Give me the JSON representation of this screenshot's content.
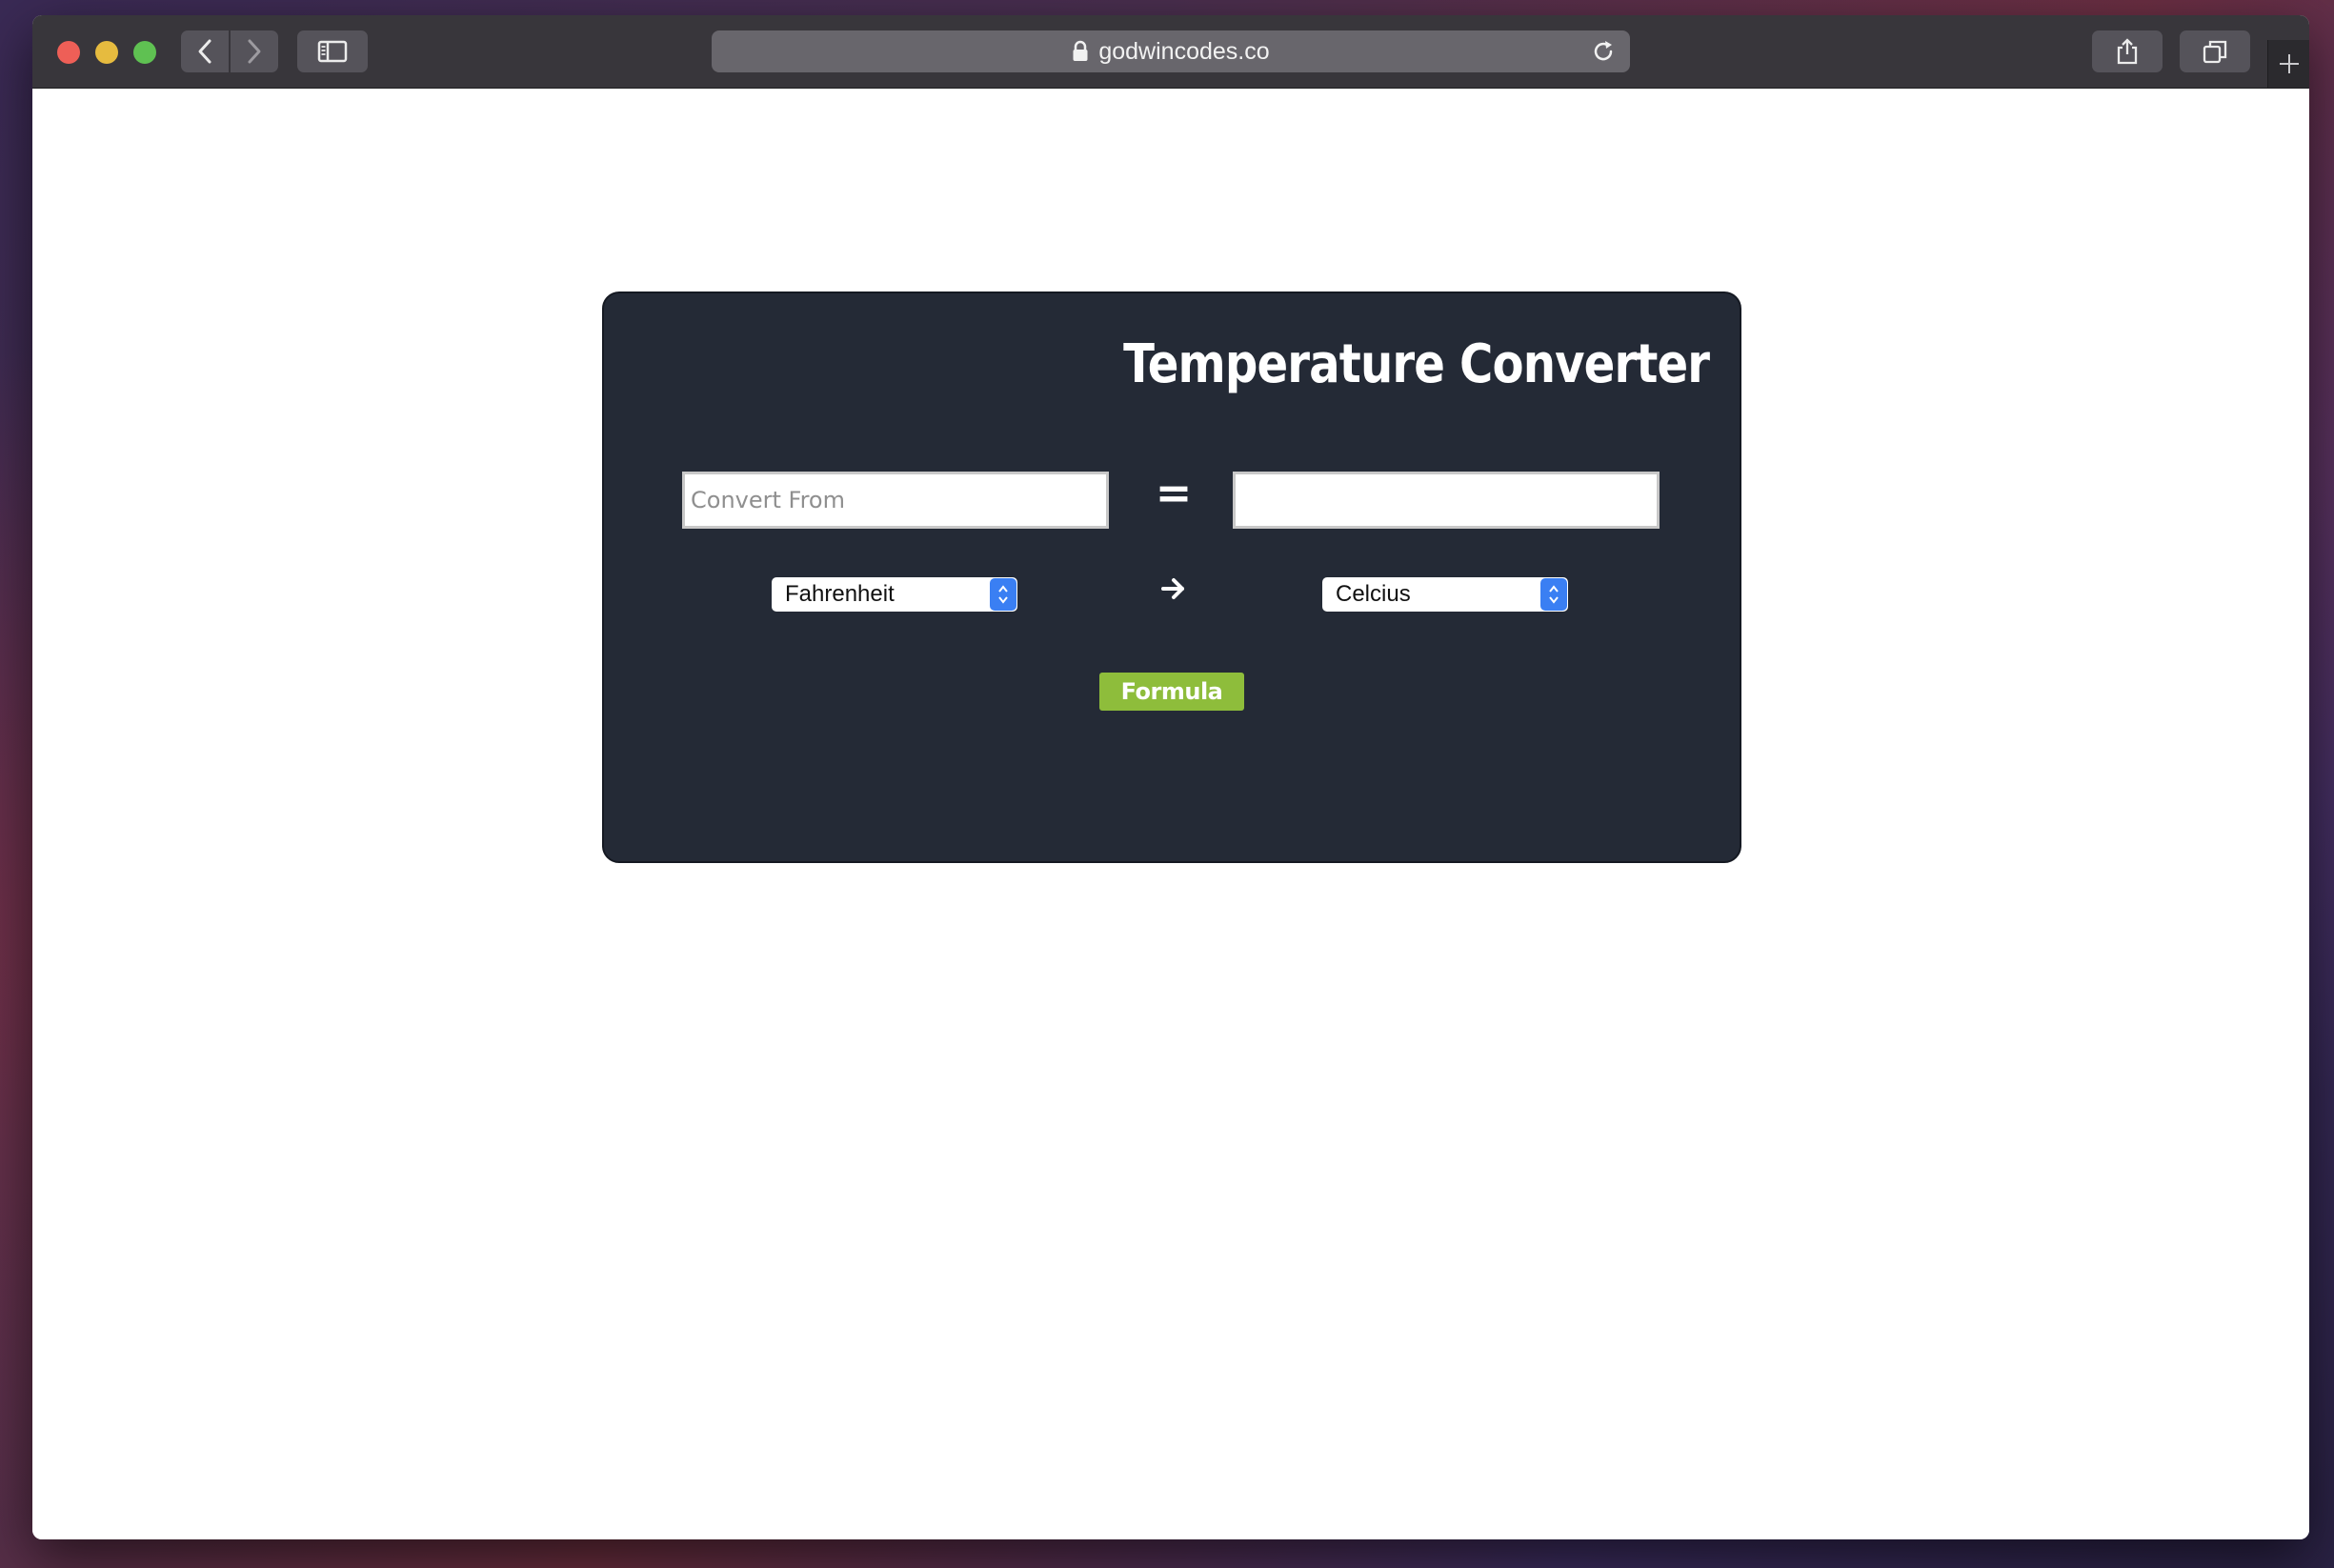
{
  "browser": {
    "url": "godwincodes.co",
    "icons": {
      "back": "chevron-left-icon",
      "forward": "chevron-right-icon",
      "sidebar": "sidebar-icon",
      "lock": "lock-icon",
      "reload": "reload-icon",
      "share": "share-icon",
      "tabs": "tabs-overview-icon",
      "new_tab": "plus-icon"
    }
  },
  "converter": {
    "title": "Temperature Converter",
    "from_input": {
      "placeholder": "Convert From",
      "value": ""
    },
    "to_input": {
      "placeholder": "",
      "value": ""
    },
    "equals_symbol": "=",
    "from_unit": "Fahrenheit",
    "to_unit": "Celcius",
    "formula_button": "Formula",
    "colors": {
      "card_background": "#242a36",
      "button_green": "#8ebd3b",
      "select_accent": "#3a7ff3"
    }
  }
}
